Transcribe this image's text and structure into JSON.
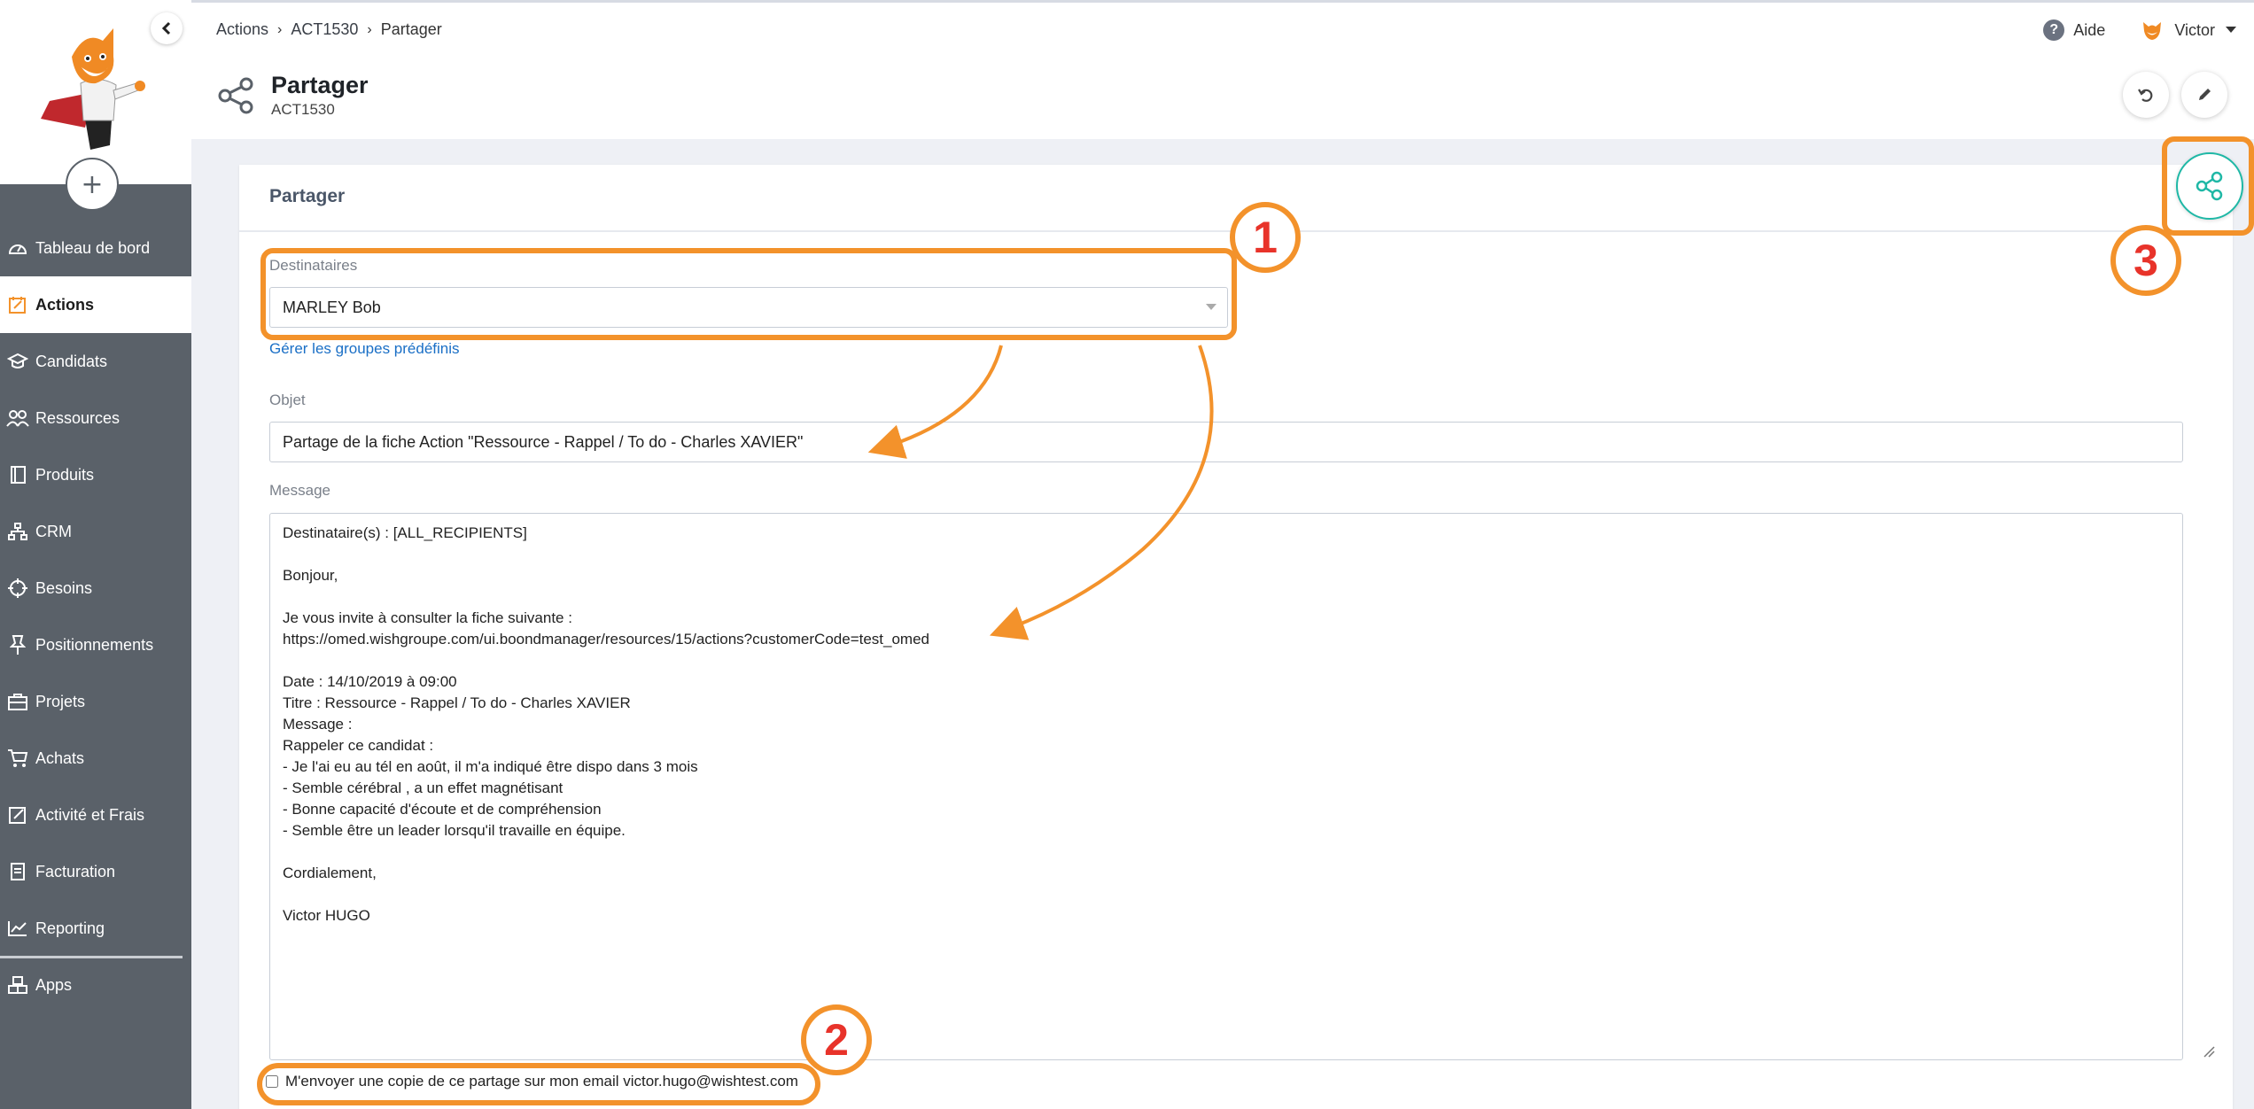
{
  "sidebar": {
    "items": [
      {
        "label": "Tableau de bord",
        "icon": "gauge-icon"
      },
      {
        "label": "Actions",
        "icon": "calendar-edit-icon",
        "active": true
      },
      {
        "label": "Candidats",
        "icon": "graduation-cap-icon"
      },
      {
        "label": "Ressources",
        "icon": "people-icon"
      },
      {
        "label": "Produits",
        "icon": "book-icon"
      },
      {
        "label": "CRM",
        "icon": "sitemap-icon"
      },
      {
        "label": "Besoins",
        "icon": "crosshair-icon"
      },
      {
        "label": "Positionnements",
        "icon": "pushpin-icon"
      },
      {
        "label": "Projets",
        "icon": "briefcase-icon"
      },
      {
        "label": "Achats",
        "icon": "cart-icon"
      },
      {
        "label": "Activité et Frais",
        "icon": "pencil-square-icon"
      },
      {
        "label": "Facturation",
        "icon": "invoice-icon"
      },
      {
        "label": "Reporting",
        "icon": "chart-line-icon"
      },
      {
        "label": "Apps",
        "icon": "cubes-icon"
      }
    ],
    "add_label": "+"
  },
  "header": {
    "breadcrumb": [
      "Actions",
      "ACT1530",
      "Partager"
    ],
    "help_label": "Aide",
    "user_name": "Victor",
    "title": "Partager",
    "subtitle": "ACT1530"
  },
  "card": {
    "title": "Partager",
    "recipients_label": "Destinataires",
    "recipients_value": "MARLEY Bob",
    "manage_groups_link": "Gérer les groupes prédéfinis",
    "subject_label": "Objet",
    "subject_value": "Partage de la fiche Action \"Ressource - Rappel / To do - Charles XAVIER\"",
    "message_label": "Message",
    "message_value": "Destinataire(s) : [ALL_RECIPIENTS]\n\nBonjour,\n\nJe vous invite à consulter la fiche suivante :\nhttps://omed.wishgroupe.com/ui.boondmanager/resources/15/actions?customerCode=test_omed\n\nDate : 14/10/2019 à 09:00\nTitre : Ressource - Rappel / To do - Charles XAVIER\nMessage :\nRappeler ce candidat :\n- Je l'ai eu au tél en août, il m'a indiqué être dispo dans 3 mois\n- Semble cérébral , a un effet magnétisant\n- Bonne capacité d'écoute et de compréhension\n- Semble être un leader lorsqu'il travaille en équipe.\n\nCordialement,\n\nVictor HUGO",
    "copy_label": "M'envoyer une copie de ce partage sur mon email victor.hugo@wishtest.com",
    "copy_checked": false
  },
  "annotations": {
    "badge_1": "1",
    "badge_2": "2",
    "badge_3": "3",
    "highlight_color": "#f3922b",
    "badge_text_color": "#e8332a"
  },
  "colors": {
    "sidebar_bg": "#5a6169",
    "link": "#1a6fc6",
    "share_accent": "#1fb8a6"
  }
}
